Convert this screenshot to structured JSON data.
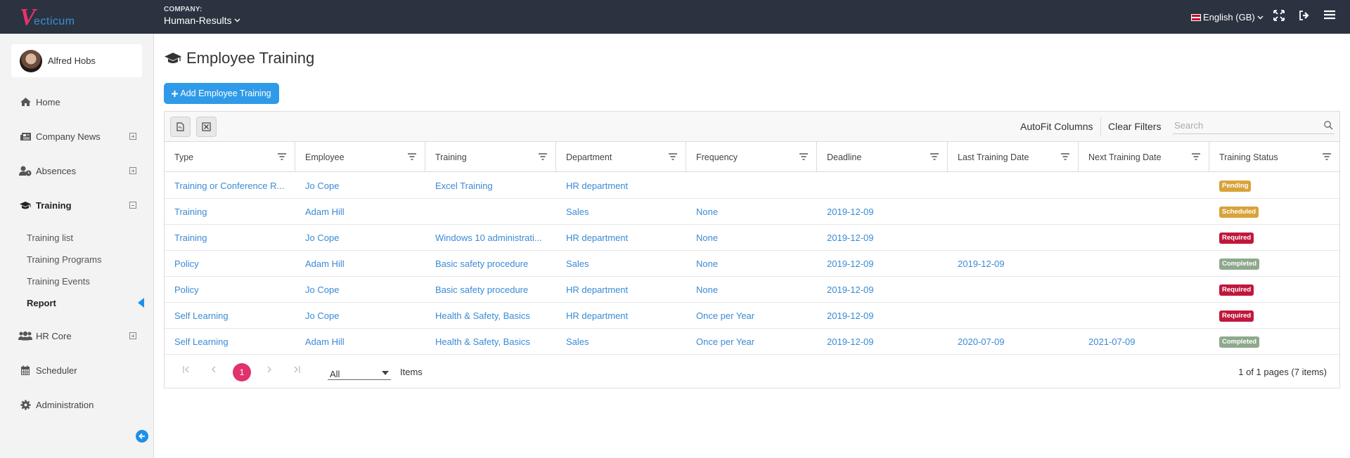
{
  "app": {
    "logo_text": "ecticum",
    "logo_letter": "V"
  },
  "header": {
    "company_label": "COMPANY:",
    "company_name": "Human-Results",
    "language": "English (GB)"
  },
  "user": {
    "name": "Alfred Hobs"
  },
  "sidebar": {
    "items": [
      {
        "label": "Home",
        "icon": "home-icon"
      },
      {
        "label": "Company News",
        "icon": "news-icon"
      },
      {
        "label": "Absences",
        "icon": "user-clock-icon"
      },
      {
        "label": "Training",
        "icon": "graduation-cap-icon"
      },
      {
        "label": "HR Core",
        "icon": "users-icon"
      },
      {
        "label": "Scheduler",
        "icon": "calendar-icon"
      },
      {
        "label": "Administration",
        "icon": "gear-icon"
      }
    ],
    "training_sub": [
      "Training list",
      "Training Programs",
      "Training Events",
      "Report"
    ]
  },
  "page": {
    "title": "Employee Training",
    "add_button": "Add Employee Training"
  },
  "toolbar": {
    "autofit": "AutoFit Columns",
    "clear_filters": "Clear Filters",
    "search_placeholder": "Search"
  },
  "table": {
    "columns": [
      "Type",
      "Employee",
      "Training",
      "Department",
      "Frequency",
      "Deadline",
      "Last Training Date",
      "Next Training Date",
      "Training Status"
    ],
    "rows": [
      [
        "Training or Conference R...",
        "Jo Cope",
        "Excel Training",
        "HR department",
        "",
        "",
        "",
        "",
        "Pending"
      ],
      [
        "Training",
        "Adam Hill",
        "",
        "Sales",
        "None",
        "2019-12-09",
        "",
        "",
        "Scheduled"
      ],
      [
        "Training",
        "Jo Cope",
        "Windows 10 administrati...",
        "HR department",
        "None",
        "2019-12-09",
        "",
        "",
        "Required"
      ],
      [
        "Policy",
        "Adam Hill",
        "Basic safety procedure",
        "Sales",
        "None",
        "2019-12-09",
        "2019-12-09",
        "",
        "Completed"
      ],
      [
        "Policy",
        "Jo Cope",
        "Basic safety procedure",
        "HR department",
        "None",
        "2019-12-09",
        "",
        "",
        "Required"
      ],
      [
        "Self Learning",
        "Jo Cope",
        "Health & Safety, Basics",
        "HR department",
        "Once per Year",
        "2019-12-09",
        "",
        "",
        "Required"
      ],
      [
        "Self Learning",
        "Adam Hill",
        "Health & Safety, Basics",
        "Sales",
        "Once per Year",
        "2019-12-09",
        "2020-07-09",
        "2021-07-09",
        "Completed"
      ]
    ]
  },
  "status_colors": {
    "Pending": "#d9a33a",
    "Scheduled": "#d9a33a",
    "Required": "#c0183c",
    "Completed": "#8ea98c"
  },
  "pager": {
    "current_page": "1",
    "page_size": "All",
    "items_label": "Items",
    "info": "1 of 1 pages (7 items)"
  }
}
